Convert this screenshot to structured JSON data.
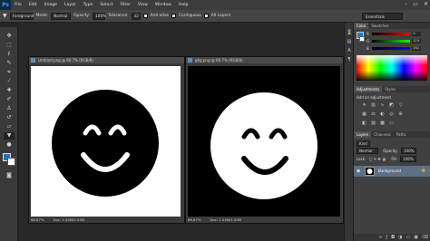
{
  "menubar": {
    "logo": "Ps",
    "items": [
      "File",
      "Edit",
      "Image",
      "Layer",
      "Type",
      "Select",
      "Filter",
      "View",
      "Window",
      "Help"
    ],
    "win_controls": [
      "–",
      "▭",
      "✕"
    ]
  },
  "options": {
    "preset": "Foreground",
    "mode_label": "Mode:",
    "mode_value": "Normal",
    "opacity_label": "Opacity:",
    "opacity_value": "100%",
    "tolerance_label": "Tolerance:",
    "tolerance_value": "32",
    "anti_alias_label": "Anti-alias",
    "contiguous_label": "Contiguous",
    "all_layers_label": "All Layers",
    "workspace": "Essentials"
  },
  "docs": [
    {
      "tab": "Untitled.png @ 66.7% (RGB/8)",
      "zoom": "66.67%",
      "info": "Doc: 1.54M/1.54M",
      "bg": "#ffffff",
      "face": "#000000"
    },
    {
      "tab": "g6g.png @ 66.7% (RGB/8)",
      "zoom": "66.67%",
      "info": "Doc: 1.54M/1.54M",
      "bg": "#000000",
      "face": "#ffffff"
    }
  ],
  "color_panel": {
    "tabs": [
      "Color",
      "Swatches"
    ],
    "r": "0",
    "g": "119",
    "b": "201",
    "accent": "#1f77c9"
  },
  "adjustments": {
    "tabs": [
      "Adjustments",
      "Styles"
    ],
    "title": "Add an adjustment"
  },
  "layers": {
    "tabs": [
      "Layers",
      "Channels",
      "Paths"
    ],
    "kind": "Kind",
    "mode": "Normal",
    "opacity_label": "Opacity:",
    "opacity_value": "100%",
    "lock_label": "Lock:",
    "fill_label": "Fill:",
    "fill_value": "100%",
    "layer_name": "Background"
  }
}
